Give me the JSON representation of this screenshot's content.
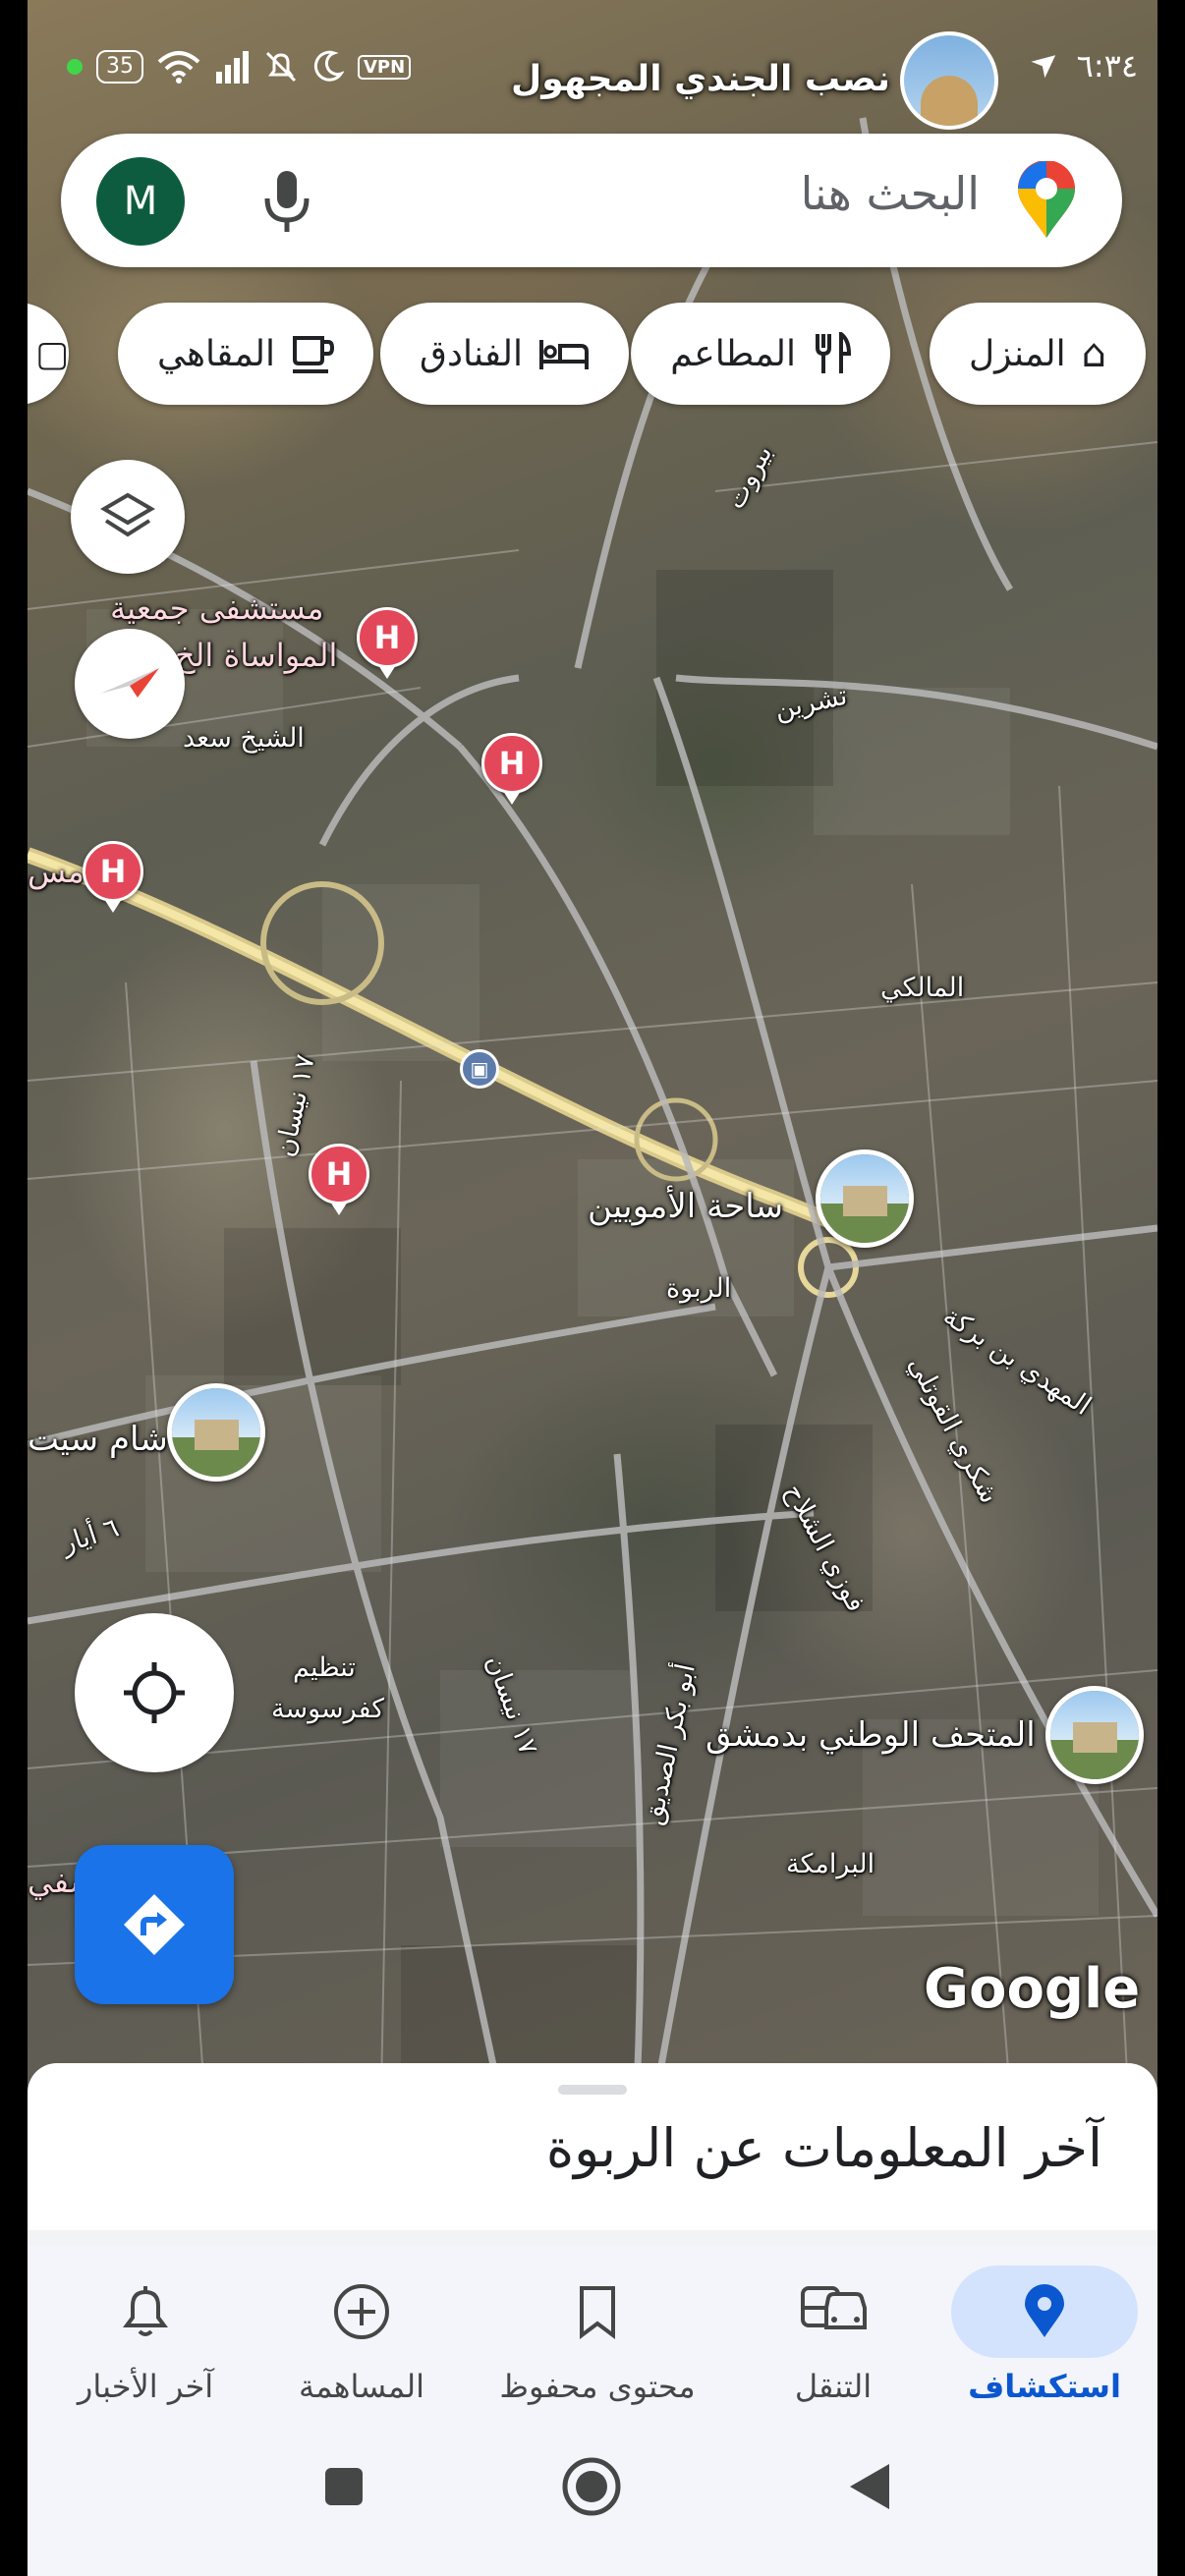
{
  "status_bar": {
    "time": "٦:٣٤",
    "battery": "35",
    "vpn": "VPN",
    "place_title": "نصب الجندي المجهول"
  },
  "search": {
    "placeholder": "البحث هنا",
    "avatar_letter": "M"
  },
  "chips": [
    {
      "label": "المنزل",
      "icon": "home-icon"
    },
    {
      "label": "المطاعم",
      "icon": "restaurant-icon"
    },
    {
      "label": "الفنادق",
      "icon": "hotel-icon"
    },
    {
      "label": "المقاهي",
      "icon": "cafe-icon"
    }
  ],
  "map_labels": {
    "hospital_1_line1": "مستشفى جمعية",
    "hospital_1_line2": "المواساة الخ",
    "sheikh_saad": "الشيخ سعد",
    "beirut": "بيروت",
    "tishreen": "تشرين",
    "malki": "المالكي",
    "umayyad_square": "ساحة الأمويين",
    "rabwa": "الربوة",
    "mahdi_barakeh": "المهدي بن بركة",
    "sham_city": "شام سيت",
    "sixth_may": "٦ أيار",
    "nisan_17_a": "١٧ نيسان",
    "nisan_17_b": "١٧ نيسان",
    "tanzim_line1": "تنظيم",
    "tanzim_line2": "كفرسوسة",
    "abu_bakr": "أبو بكر الصديق",
    "fawzi_shallah": "فوزي الشلاح",
    "shukri_quwatli": "شكري القوتلي",
    "national_museum": "المتحف الوطني بدمشق",
    "baramkeh": "البرامكة",
    "masa_left": "مس",
    "shafi_left": "شفي",
    "google": "Google"
  },
  "sheet": {
    "title": "آخر المعلومات عن الربوة"
  },
  "bottom_nav": [
    {
      "label": "استكشاف",
      "icon": "explore-pin-icon",
      "active": true
    },
    {
      "label": "التنقل",
      "icon": "commute-icon",
      "active": false
    },
    {
      "label": "محتوى محفوظ",
      "icon": "bookmark-icon",
      "active": false
    },
    {
      "label": "المساهمة",
      "icon": "add-circle-icon",
      "active": false
    },
    {
      "label": "آخر الأخبار",
      "icon": "bell-icon",
      "active": false
    }
  ],
  "colors": {
    "accent": "#1a73e8",
    "active_nav": "#0b57d0",
    "hospital_pin": "#e3475a"
  }
}
